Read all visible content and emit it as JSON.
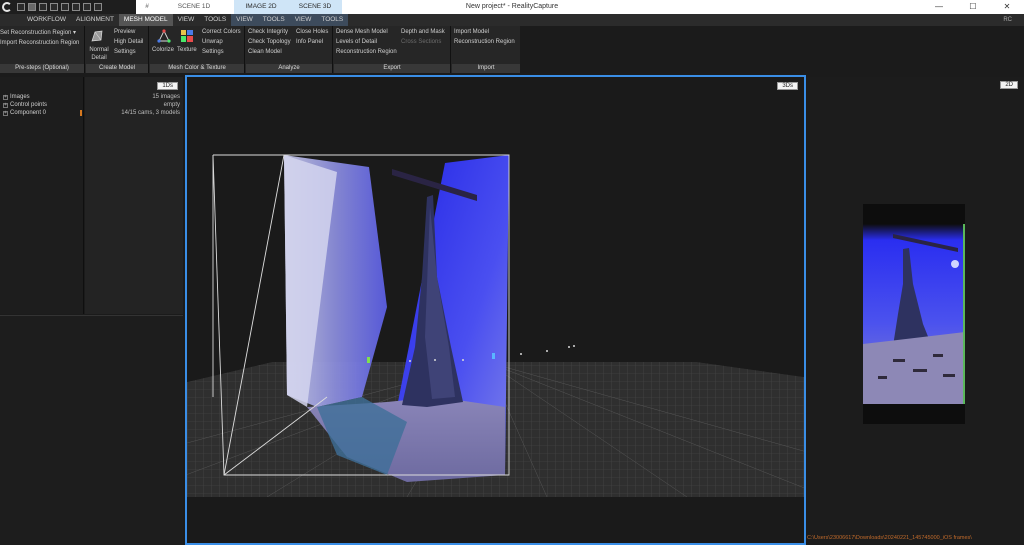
{
  "window": {
    "title": "New project* - RealityCapture",
    "scene_tabs": [
      {
        "label": "#",
        "selected": false
      },
      {
        "label": "SCENE 1D",
        "selected": false
      },
      {
        "label": "IMAGE 2D",
        "selected": true
      },
      {
        "label": "SCENE 3D",
        "selected": true
      }
    ],
    "controls": [
      "—",
      "☐",
      "✕"
    ]
  },
  "menu": {
    "tabs": [
      "WORKFLOW",
      "ALIGNMENT",
      "MESH MODEL",
      "VIEW",
      "TOOLS",
      "VIEW",
      "TOOLS",
      "VIEW",
      "TOOLS"
    ],
    "selected": "MESH MODEL",
    "right": "RC"
  },
  "ribbon": {
    "presteps": {
      "items": [
        "Set Reconstruction Region ▾",
        "Import Reconstruction Region"
      ],
      "title": "Pre-steps (Optional)"
    },
    "create_model": {
      "big": "Normal Detail",
      "items": [
        "Preview",
        "High Detail",
        "Settings"
      ],
      "title": "Create Model"
    },
    "mesh_color": {
      "big1": "Colorize",
      "big2": "Texture",
      "items": [
        "Correct Colors",
        "Unwrap",
        "Settings"
      ],
      "title": "Mesh Color & Texture"
    },
    "analyze": {
      "col1": [
        "Check Integrity",
        "Check Topology",
        "Clean Model"
      ],
      "col2": [
        "Close Holes",
        "Info Panel"
      ],
      "title": "Analyze"
    },
    "export": {
      "col1": [
        "Dense Mesh Model",
        "Levels of Detail",
        "Reconstruction Region"
      ],
      "col2": [
        "Depth and Mask",
        "Cross Sections"
      ],
      "title": "Export"
    },
    "import": {
      "items": [
        "Import Model",
        "Reconstruction Region"
      ],
      "title": "Import"
    }
  },
  "panel": {
    "tree": [
      "Images",
      "Control points",
      "Component 0"
    ],
    "badge": "1Ds",
    "stats": [
      "15 images",
      "empty",
      "14/15 cams, 3 models"
    ]
  },
  "view3d": {
    "badge": "3Ds"
  },
  "view2d": {
    "badge": "2D"
  },
  "status": {
    "path": "C:\\Users\\23006617\\Downloads\\20240221_145745000_iOS frames\\"
  },
  "colors": {
    "accent": "#3a8ee6",
    "ribbon_bg": "#262626",
    "group_title_bg": "#383838",
    "scene_blue": "#2a2ce8"
  }
}
